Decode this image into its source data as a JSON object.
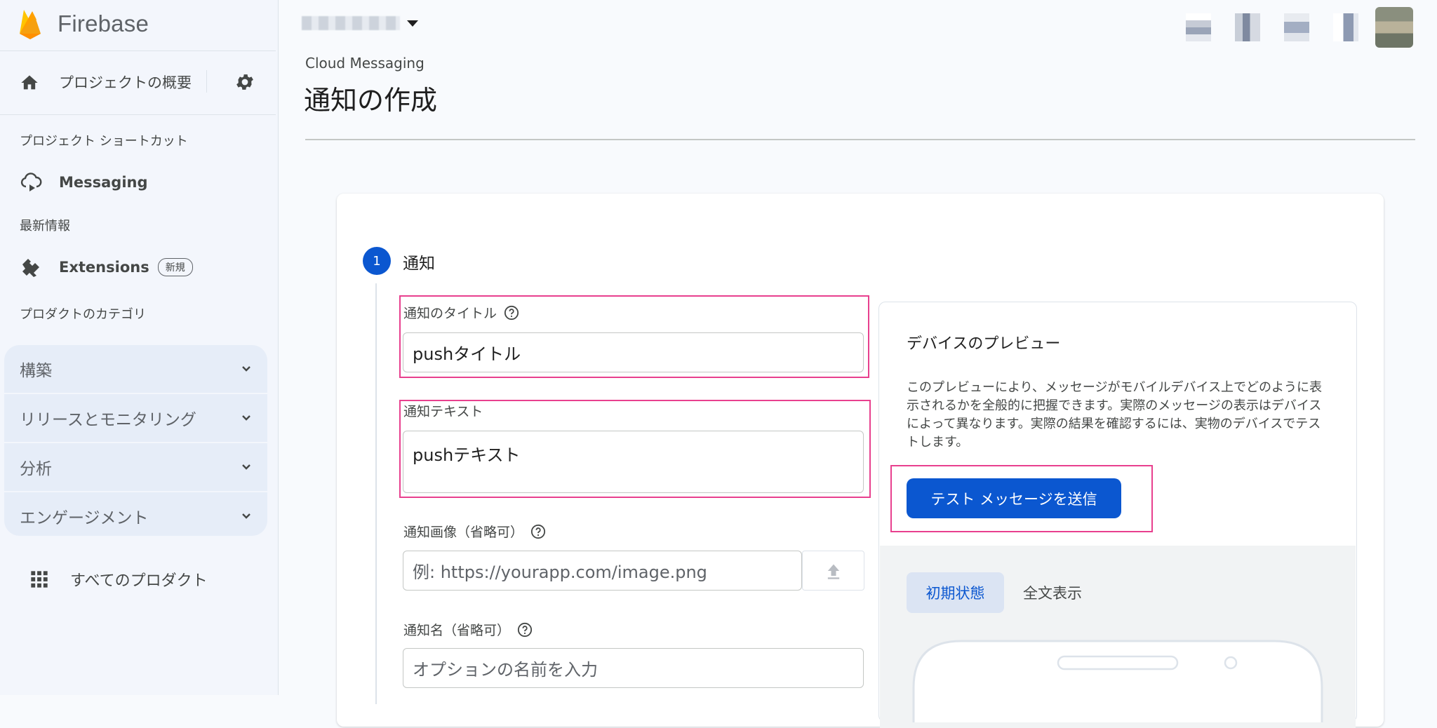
{
  "sidebar": {
    "brand": "Firebase",
    "project_overview": "プロジェクトの概要",
    "shortcuts_label": "プロジェクト ショートカット",
    "messaging": "Messaging",
    "whats_new_label": "最新情報",
    "extensions": "Extensions",
    "extensions_badge": "新規",
    "categories_label": "プロダクトのカテゴリ",
    "categories": [
      {
        "label": "構築"
      },
      {
        "label": "リリースとモニタリング"
      },
      {
        "label": "分析"
      },
      {
        "label": "エンゲージメント"
      }
    ],
    "all_products": "すべてのプロダクト"
  },
  "header": {
    "breadcrumb": "Cloud Messaging",
    "title": "通知の作成"
  },
  "step": {
    "number": "1",
    "title": "通知"
  },
  "form": {
    "title_label": "通知のタイトル",
    "title_value": "pushタイトル",
    "text_label": "通知テキスト",
    "text_value": "pushテキスト",
    "image_label": "通知画像（省略可）",
    "image_placeholder": "例: https://yourapp.com/image.png",
    "name_label": "通知名（省略可）",
    "name_placeholder": "オプションの名前を入力"
  },
  "preview": {
    "title": "デバイスのプレビュー",
    "description": "このプレビューにより、メッセージがモバイルデバイス上でどのように表示されるかを全般的に把握できます。実際のメッセージの表示はデバイスによって異なります。実際の結果を確認するには、実物のデバイスでテストします。",
    "test_button": "テスト メッセージを送信",
    "tab_initial": "初期状態",
    "tab_full": "全文表示"
  },
  "colors": {
    "primary": "#0b57d0",
    "highlight": "#e8408e",
    "sidebar_bg": "#f3f6fc"
  },
  "icons": [
    "firebase-logo",
    "home-icon",
    "gear-icon",
    "messaging-icon",
    "extensions-icon",
    "chevron-down-icon",
    "apps-grid-icon",
    "help-icon",
    "upload-icon"
  ]
}
